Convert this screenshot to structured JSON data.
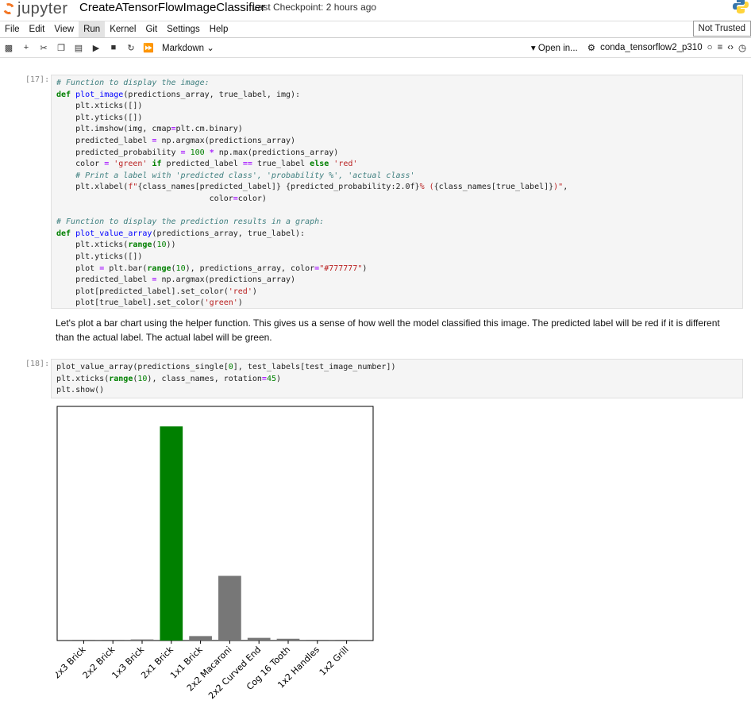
{
  "header": {
    "logo_text": "jupyter",
    "notebook_title": "CreateATensorFlowImageClassifier",
    "checkpoint": "Last Checkpoint: 2 hours ago"
  },
  "menu": {
    "items": [
      "File",
      "Edit",
      "View",
      "Run",
      "Kernel",
      "Git",
      "Settings",
      "Help"
    ],
    "trusted_label": "Not Trusted"
  },
  "toolbar": {
    "cell_type": "Markdown",
    "open_in": "Open in...",
    "kernel_name": "conda_tensorflow2_p310"
  },
  "cells": {
    "c17_prompt": "[17]:",
    "c18_prompt": "[18]:",
    "markdown_text": "Let's plot a bar chart using the helper function. This gives us a sense of how well the model classified this image. The predicted label will be red if it is different than the actual label. The actual label will be green."
  },
  "chart_data": {
    "type": "bar",
    "categories": [
      "2x3 Brick",
      "2x2 Brick",
      "1x3 Brick",
      "2x1 Brick",
      "1x1 Brick",
      "2x2 Macaroni",
      "2x2 Curved End",
      "Cog 16 Tooth",
      "1x2 Handles",
      "1x2 Grill"
    ],
    "values": [
      0.001,
      0.003,
      0.005,
      0.96,
      0.02,
      0.29,
      0.012,
      0.008,
      0.002,
      0.002
    ],
    "colors": [
      "#777777",
      "#777777",
      "#777777",
      "#008000",
      "#777777",
      "#777777",
      "#777777",
      "#777777",
      "#777777",
      "#777777"
    ],
    "title": "",
    "xlabel": "",
    "ylabel": "",
    "ylim": [
      0,
      1
    ],
    "grid": false
  }
}
